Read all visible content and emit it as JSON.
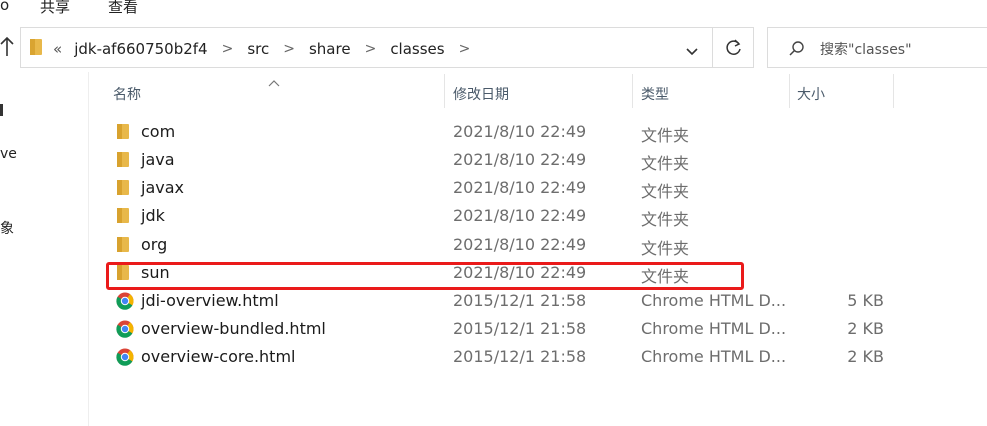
{
  "ribbon": {
    "tabs": [
      "共享",
      "查看"
    ]
  },
  "address": {
    "overflow": "«",
    "breadcrumbs": [
      "jdk-af660750b2f4",
      "src",
      "share",
      "classes"
    ]
  },
  "search": {
    "placeholder": "搜索\"classes\""
  },
  "nav_fragments": [
    "ve",
    "象"
  ],
  "columns": {
    "name": "名称",
    "date": "修改日期",
    "type": "类型",
    "size": "大小"
  },
  "files": [
    {
      "name": "com",
      "date": "2021/8/10 22:49",
      "type": "文件夹",
      "size": "",
      "icon": "folder-icon"
    },
    {
      "name": "java",
      "date": "2021/8/10 22:49",
      "type": "文件夹",
      "size": "",
      "icon": "folder-icon"
    },
    {
      "name": "javax",
      "date": "2021/8/10 22:49",
      "type": "文件夹",
      "size": "",
      "icon": "folder-icon"
    },
    {
      "name": "jdk",
      "date": "2021/8/10 22:49",
      "type": "文件夹",
      "size": "",
      "icon": "folder-icon"
    },
    {
      "name": "org",
      "date": "2021/8/10 22:49",
      "type": "文件夹",
      "size": "",
      "icon": "folder-icon"
    },
    {
      "name": "sun",
      "date": "2021/8/10 22:49",
      "type": "文件夹",
      "size": "",
      "icon": "folder-icon"
    },
    {
      "name": "jdi-overview.html",
      "date": "2015/12/1 21:58",
      "type": "Chrome HTML D...",
      "size": "5 KB",
      "icon": "chrome-icon"
    },
    {
      "name": "overview-bundled.html",
      "date": "2015/12/1 21:58",
      "type": "Chrome HTML D...",
      "size": "2 KB",
      "icon": "chrome-icon"
    },
    {
      "name": "overview-core.html",
      "date": "2015/12/1 21:58",
      "type": "Chrome HTML D...",
      "size": "2 KB",
      "icon": "chrome-icon"
    }
  ],
  "colors": {
    "folder": "#e8b84a",
    "highlight": "#ea1a1a",
    "secondary_text": "#6d6d6d"
  }
}
